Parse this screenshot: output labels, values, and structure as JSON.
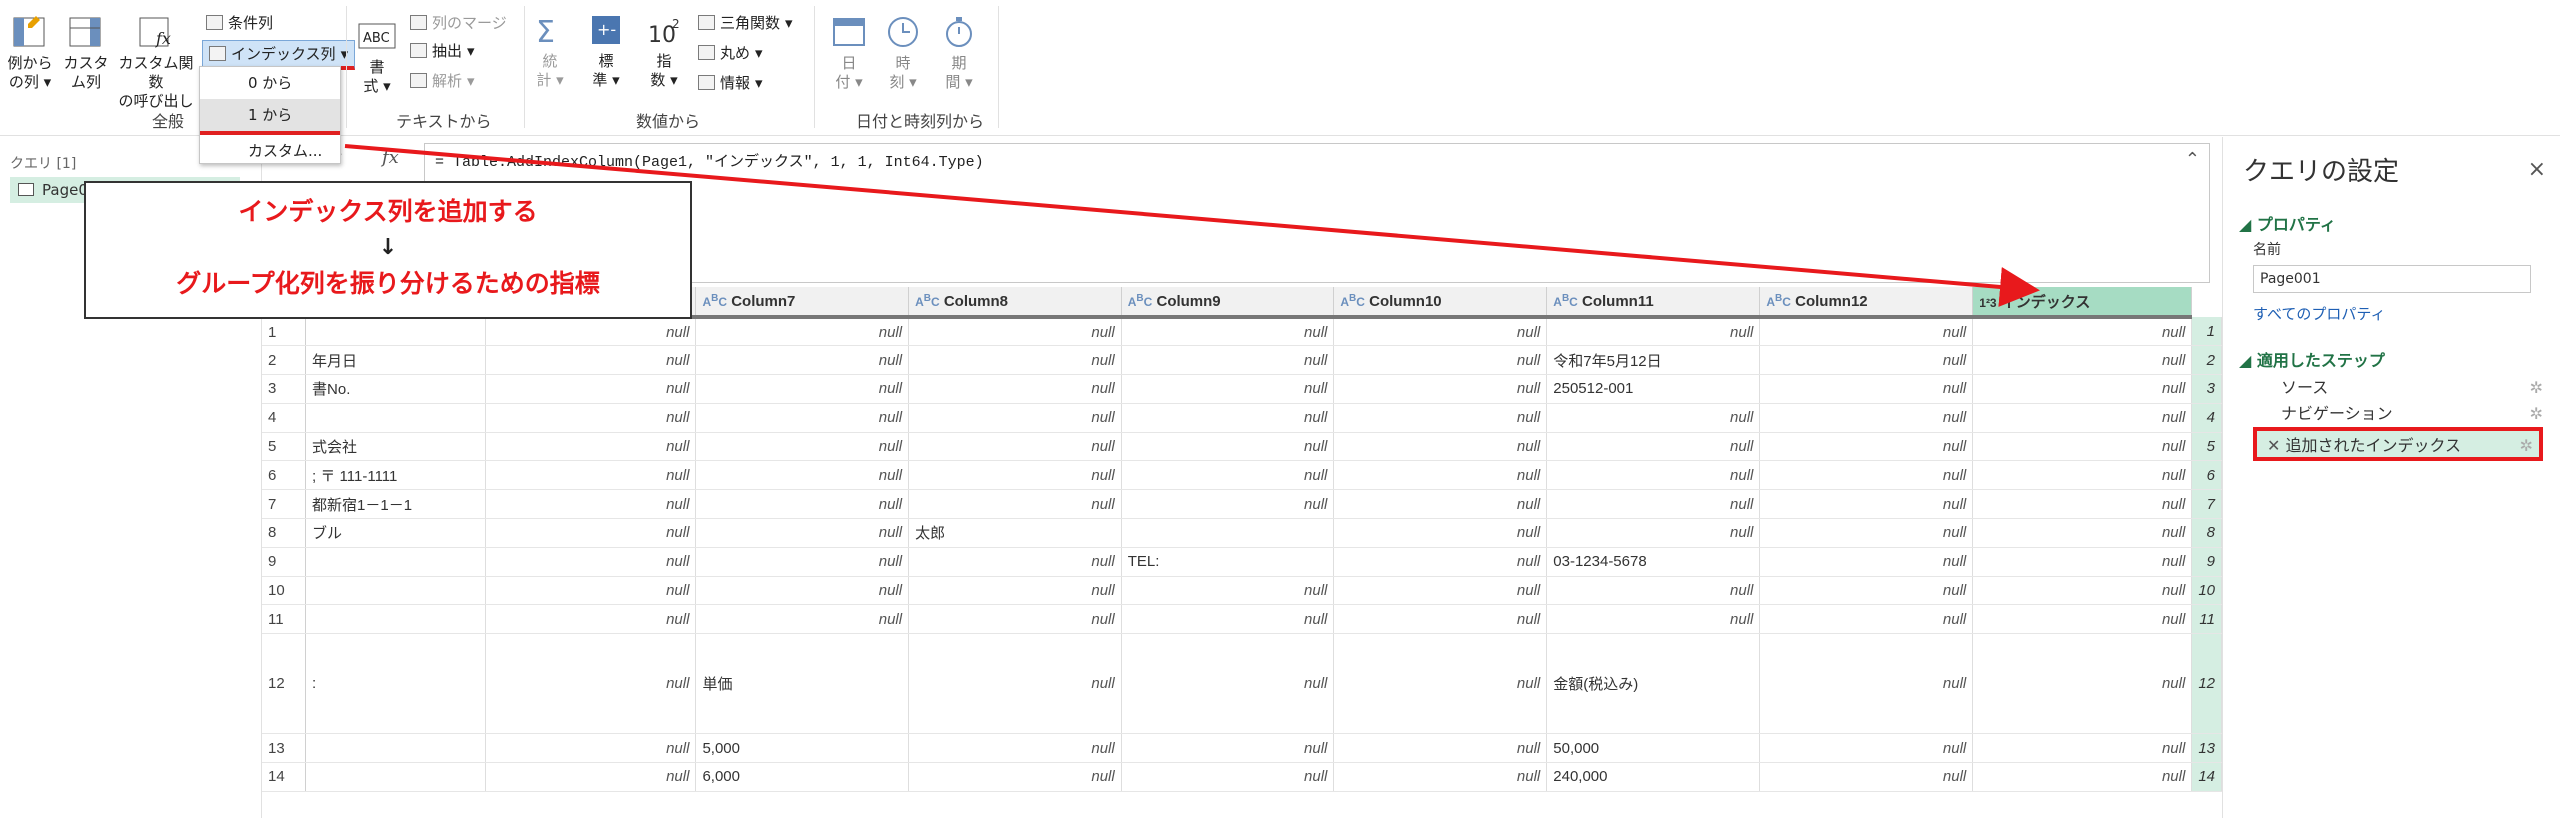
{
  "ribbon": {
    "col_from_examples": [
      "例から",
      "の列"
    ],
    "custom_col": [
      "カスタ",
      "ム列"
    ],
    "invoke_custom": [
      "カスタム関数",
      "の呼び出し"
    ],
    "conditional": "条件列",
    "index_col": "インデックス列",
    "group_general": "全般",
    "format": [
      "書",
      "式"
    ],
    "merge_cols": "列のマージ",
    "extract": "抽出",
    "parse": "解析",
    "group_text": "テキストから",
    "stats": [
      "統",
      "計"
    ],
    "standard": [
      "標",
      "準"
    ],
    "scientific": [
      "指",
      "数"
    ],
    "trig": "三角関数",
    "rounding": "丸め",
    "info": "情報",
    "group_number": "数値から",
    "date": [
      "日",
      "付"
    ],
    "time": [
      "時",
      "刻"
    ],
    "duration": [
      "期",
      "間"
    ],
    "group_datetime": "日付と時刻列から"
  },
  "menu": {
    "items": [
      "0 から",
      "1 から",
      "カスタム..."
    ]
  },
  "queries": {
    "header": "クエリ [1]",
    "item": "Page001"
  },
  "formula": "= Table.AddIndexColumn(Page1, \"インデックス\", 1, 1, Int64.Type)",
  "callout": {
    "line1": "インデックス列を追加する",
    "arrow": "↓",
    "line2": "グループ化列を振り分けるための指標"
  },
  "table": {
    "headers": [
      "Column7",
      "Column8",
      "Column9",
      "Column10",
      "Column11",
      "Column12",
      "インデックス"
    ],
    "rows": [
      {
        "n": "1",
        "c": [
          "",
          "null",
          "null",
          "null",
          "null",
          "null",
          "null",
          "null",
          "null",
          "1"
        ]
      },
      {
        "n": "2",
        "c": [
          "年月日",
          "null",
          "null",
          "null",
          "null",
          "null",
          "令和7年5月12日",
          "null",
          "null",
          "2"
        ]
      },
      {
        "n": "3",
        "c": [
          "書No.",
          "null",
          "null",
          "null",
          "null",
          "null",
          "250512-001",
          "null",
          "null",
          "3"
        ]
      },
      {
        "n": "4",
        "c": [
          "",
          "null",
          "null",
          "null",
          "null",
          "null",
          "null",
          "null",
          "null",
          "4"
        ]
      },
      {
        "n": "5",
        "c": [
          "式会社",
          "null",
          "null",
          "null",
          "null",
          "null",
          "null",
          "null",
          "null",
          "5"
        ]
      },
      {
        "n": "6",
        "c": [
          "; 〒 111-1111",
          "null",
          "null",
          "null",
          "null",
          "null",
          "null",
          "null",
          "null",
          "6"
        ]
      },
      {
        "n": "7",
        "c": [
          "都新宿1－1－1",
          "null",
          "null",
          "null",
          "null",
          "null",
          "null",
          "null",
          "null",
          "7"
        ]
      },
      {
        "n": "8",
        "c": [
          "ブル",
          "null",
          "null",
          "太郎",
          "",
          "null",
          "null",
          "null",
          "null",
          "8"
        ]
      },
      {
        "n": "9",
        "c": [
          "",
          "null",
          "null",
          "null",
          "TEL:",
          "null",
          "03-1234-5678",
          "null",
          "null",
          "9"
        ]
      },
      {
        "n": "10",
        "c": [
          "",
          "null",
          "null",
          "null",
          "null",
          "null",
          "null",
          "null",
          "null",
          "10"
        ]
      },
      {
        "n": "11",
        "c": [
          "",
          "null",
          "null",
          "null",
          "null",
          "null",
          "null",
          "null",
          "null",
          "11"
        ]
      },
      {
        "n": "12",
        "c": [
          ":",
          "null",
          "単価",
          "null",
          "null",
          "null",
          "金額(税込み)",
          "null",
          "null",
          "12"
        ]
      },
      {
        "n": "13",
        "c": [
          "",
          "null",
          "5,000",
          "null",
          "null",
          "null",
          "50,000",
          "null",
          "null",
          "13"
        ]
      },
      {
        "n": "14",
        "c": [
          "",
          "null",
          "6,000",
          "null",
          "null",
          "null",
          "240,000",
          "null",
          "null",
          "14"
        ]
      }
    ]
  },
  "settings": {
    "title": "クエリの設定",
    "properties": "プロパティ",
    "name_label": "名前",
    "name_value": "Page001",
    "all_props": "すべてのプロパティ",
    "applied_steps": "適用したステップ",
    "steps": [
      "ソース",
      "ナビゲーション",
      "追加されたインデックス"
    ]
  },
  "colors": {
    "highlight": "#e8191c",
    "index_col": "#d5eee2",
    "accent": "#217346"
  }
}
